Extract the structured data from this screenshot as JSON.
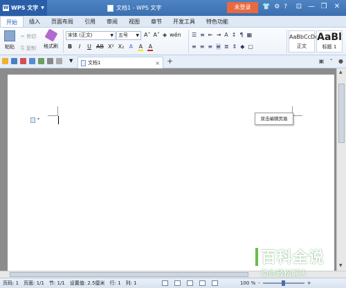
{
  "titlebar": {
    "app_name": "WPS 文字",
    "doc_title": "文档1 - WPS 文字",
    "login_label": "未登录",
    "icons": [
      "shirt-icon",
      "settings-icon",
      "help-icon"
    ],
    "help_text": "?"
  },
  "tabs": [
    "开始",
    "插入",
    "页面布局",
    "引用",
    "审阅",
    "视图",
    "章节",
    "开发工具",
    "特色功能"
  ],
  "active_tab": "开始",
  "ribbon": {
    "paste_label": "粘贴",
    "cut_label": "剪切",
    "copy_label": "复制",
    "format_painter_label": "格式刷",
    "font_name": "宋体 (正文)",
    "font_size": "五号",
    "format_buttons": [
      "B",
      "I",
      "U",
      "AB",
      "X²",
      "X₂",
      "A",
      "A",
      "A"
    ],
    "styles": [
      {
        "sample": "AaBbCcDd",
        "name": "正文"
      },
      {
        "sample": "AaBl",
        "name": "标题 1"
      }
    ]
  },
  "document_tab": {
    "name": "文档1",
    "close": "×",
    "new": "+"
  },
  "document": {
    "header_tip": "双击编辑页眉"
  },
  "statusbar": {
    "page": "页码: 1",
    "pages": "页面: 1/1",
    "section": "节: 1/1",
    "setting": "设置值: 2.5厘米",
    "row": "行: 1",
    "column": "列: 1",
    "zoom": "100 %",
    "zoom_minus": "-",
    "zoom_plus": "+"
  },
  "watermark": {
    "title": "百科全说",
    "subtitle": "助你轻松解决"
  },
  "colors": {
    "title_bar": "#3b6fb0",
    "login": "#e9693f",
    "accent": "#1f5fb8"
  }
}
